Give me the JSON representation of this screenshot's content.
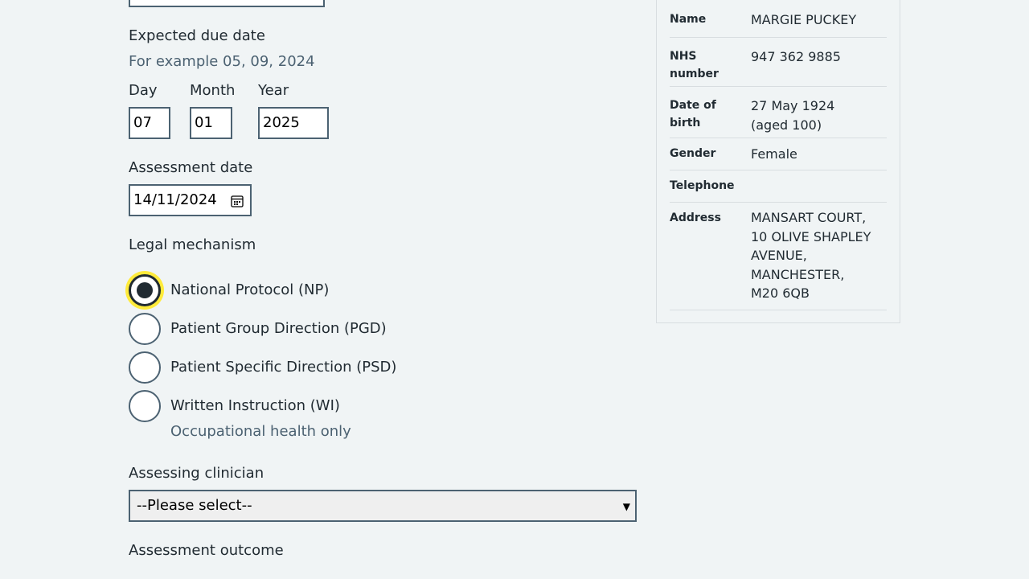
{
  "form": {
    "due_date": {
      "label": "Expected due date",
      "hint": "For example 05, 09, 2024",
      "day_label": "Day",
      "month_label": "Month",
      "year_label": "Year",
      "day": "07",
      "month": "01",
      "year": "2025"
    },
    "assessment_date": {
      "label": "Assessment date",
      "value": "14/11/2024"
    },
    "legal_mechanism": {
      "label": "Legal mechanism",
      "options": [
        {
          "label": "National Protocol (NP)",
          "checked": true
        },
        {
          "label": "Patient Group Direction (PGD)",
          "checked": false
        },
        {
          "label": "Patient Specific Direction (PSD)",
          "checked": false
        },
        {
          "label": "Written Instruction (WI)",
          "checked": false,
          "hint": "Occupational health only"
        }
      ]
    },
    "assessing_clinician": {
      "label": "Assessing clinician",
      "selected": "--Please select--"
    },
    "assessment_outcome": {
      "label": "Assessment outcome"
    }
  },
  "patient": {
    "name_key": "Name",
    "name": "MARGIE PUCKEY",
    "nhs_key_1": "NHS",
    "nhs_key_2": "number",
    "nhs": "947 362 9885",
    "dob_key_1": "Date of",
    "dob_key_2": "birth",
    "dob_1": "27 May 1924",
    "dob_2": "(aged 100)",
    "gender_key": "Gender",
    "gender": "Female",
    "telephone_key": "Telephone",
    "telephone": "",
    "address_key": "Address",
    "address_lines": [
      "MANSART COURT,",
      "10 OLIVE SHAPLEY",
      "AVENUE,",
      "MANCHESTER,",
      "M20 6QB"
    ]
  },
  "colors": {
    "focus": "#ffeb3b",
    "border": "#4c6272",
    "text": "#212b32",
    "hint": "#4c6272"
  }
}
